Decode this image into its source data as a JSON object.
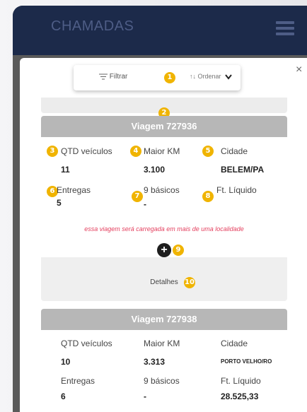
{
  "app": {
    "title": "CHAMADAS",
    "menu_icon": "hamburger-icon"
  },
  "toolbar": {
    "filter_label": "Filtrar",
    "filter_icon": "filter-lines-icon",
    "order_label": "↑↓ Ordenar",
    "order_icon": "chevron-down-icon",
    "close_label": "×"
  },
  "badges": {
    "b1": "1",
    "b2": "2",
    "b3": "3",
    "b4": "4",
    "b5": "5",
    "b6": "6",
    "b7": "7",
    "b8": "8",
    "b9": "9",
    "b10": "10"
  },
  "trips": [
    {
      "title": "Viagem 727936",
      "qtd_label": "QTD veículos",
      "qtd_value": "11",
      "km_label": "Maior KM",
      "km_value": "3.100",
      "cidade_label": "Cidade",
      "cidade_value": "BELEM/PA",
      "entregas_label": "Entregas",
      "entregas_value": "5",
      "basicos_label": "9 básicos",
      "basicos_value": "-",
      "ft_label": "Ft. Líquido",
      "ft_value": "",
      "warning": "essa viagem será carregada em mais de uma localidade",
      "plus": "+",
      "details_label": "Detalhes"
    },
    {
      "title": "Viagem 727938",
      "qtd_label": "QTD veículos",
      "qtd_value": "10",
      "km_label": "Maior KM",
      "km_value": "3.313",
      "cidade_label": "Cidade",
      "cidade_value": "PORTO VELHO/RO",
      "entregas_label": "Entregas",
      "entregas_value": "6",
      "basicos_label": "9 básicos",
      "basicos_value": "-",
      "ft_label": "Ft. Líquido",
      "ft_value": "28.525,33"
    }
  ],
  "colors": {
    "header": "#1c2a4a",
    "badge": "#f0b400",
    "card_header": "#b7b7b7",
    "warning": "#e4405f"
  }
}
